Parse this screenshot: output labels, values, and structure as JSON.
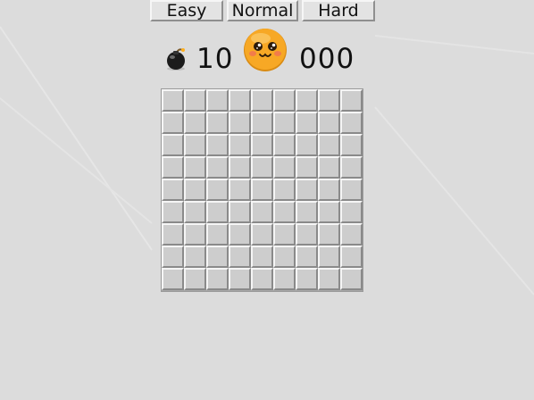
{
  "difficulty": {
    "easy_label": "Easy",
    "normal_label": "Normal",
    "hard_label": "Hard"
  },
  "status": {
    "mine_count": "10",
    "timer": "000",
    "mine_icon": "bomb-icon",
    "face_icon": "smiley-face-icon"
  },
  "board": {
    "rows": 9,
    "columns": 9,
    "cell_state": "covered"
  },
  "colors": {
    "background": "#dcdcdc",
    "cell": "#cdcdcd",
    "face": "#f7a825"
  }
}
